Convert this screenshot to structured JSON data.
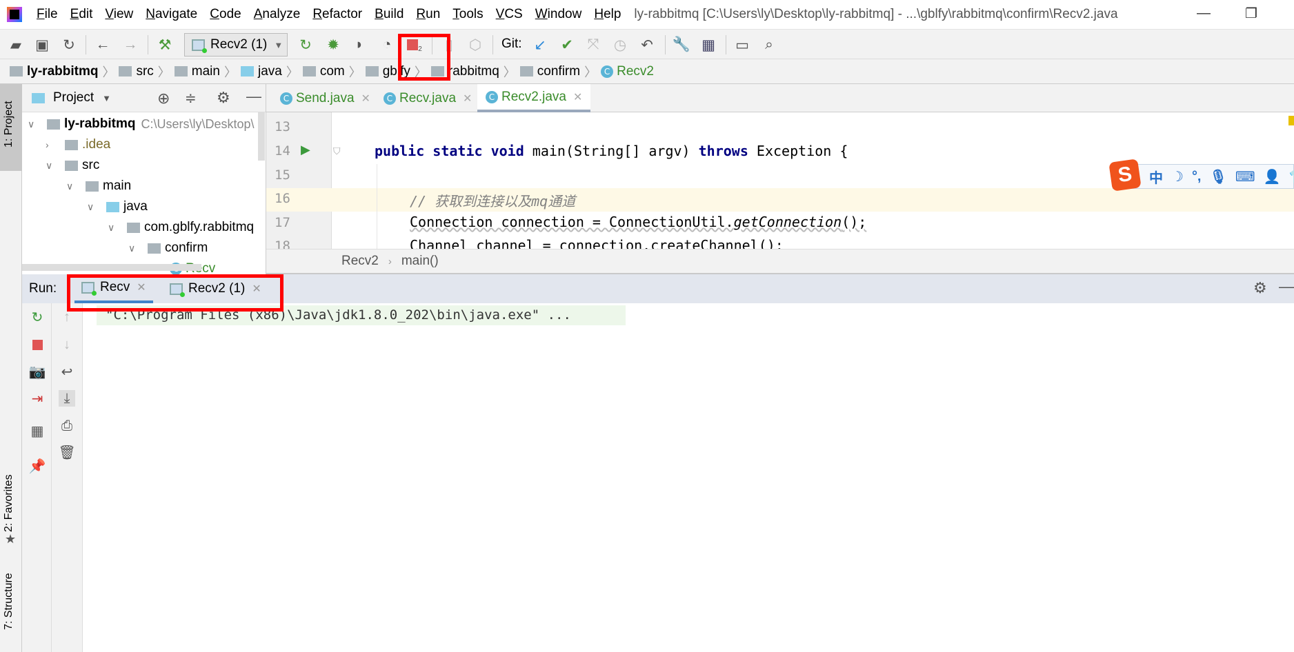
{
  "window": {
    "title": "ly-rabbitmq [C:\\Users\\ly\\Desktop\\ly-rabbitmq] - ...\\gblfy\\rabbitmq\\confirm\\Recv2.java",
    "minimize": "—",
    "restore": "❐"
  },
  "menu": [
    "File",
    "Edit",
    "View",
    "Navigate",
    "Code",
    "Analyze",
    "Refactor",
    "Build",
    "Run",
    "Tools",
    "VCS",
    "Window",
    "Help"
  ],
  "toolbar": {
    "run_config": "Recv2 (1)",
    "git_label": "Git:",
    "stop_badge": "2"
  },
  "nav_breadcrumb": [
    "ly-rabbitmq",
    "src",
    "main",
    "java",
    "com",
    "gblfy",
    "rabbitmq",
    "confirm",
    "Recv2"
  ],
  "left_strip": {
    "project": "1: Project",
    "favorites": "2: Favorites",
    "structure": "7: Structure"
  },
  "project_panel": {
    "title": "Project",
    "tree": [
      {
        "label": "ly-rabbitmq",
        "path": "C:\\Users\\ly\\Desktop\\"
      },
      {
        "label": ".idea"
      },
      {
        "label": "src"
      },
      {
        "label": "main"
      },
      {
        "label": "java"
      },
      {
        "label": "com.gblfy.rabbitmq"
      },
      {
        "label": "confirm"
      },
      {
        "label": "Recv"
      }
    ]
  },
  "editor_tabs": [
    {
      "label": "Send.java",
      "active": false
    },
    {
      "label": "Recv.java",
      "active": false
    },
    {
      "label": "Recv2.java",
      "active": true
    }
  ],
  "code_lines": [
    {
      "n": "13"
    },
    {
      "n": "14",
      "kw": "public static void",
      "rest": " main(String[] argv) ",
      "kw2": "throws",
      "rest2": " Exception {"
    },
    {
      "n": "15"
    },
    {
      "n": "16",
      "comment": "// 获取到连接以及mq通道"
    },
    {
      "n": "17",
      "text": "Connection connection = ConnectionUtil.",
      "italic": "getConnection",
      "tail": "();"
    },
    {
      "n": "18",
      "text": "Channel channel = connection.createChannel();"
    }
  ],
  "editor_breadcrumb": [
    "Recv2",
    "main()"
  ],
  "run_panel": {
    "label": "Run:",
    "tabs": [
      {
        "label": "Recv",
        "active": true
      },
      {
        "label": "Recv2 (1)",
        "active": false
      }
    ],
    "console": "\"C:\\Program Files (x86)\\Java\\jdk1.8.0_202\\bin\\java.exe\" ..."
  },
  "ime_toolbar": {
    "logo": "S",
    "mode": "中"
  },
  "colors": {
    "highlight_box": "#ff0000",
    "accent_green": "#3a8c2b",
    "keyword": "#000080"
  }
}
